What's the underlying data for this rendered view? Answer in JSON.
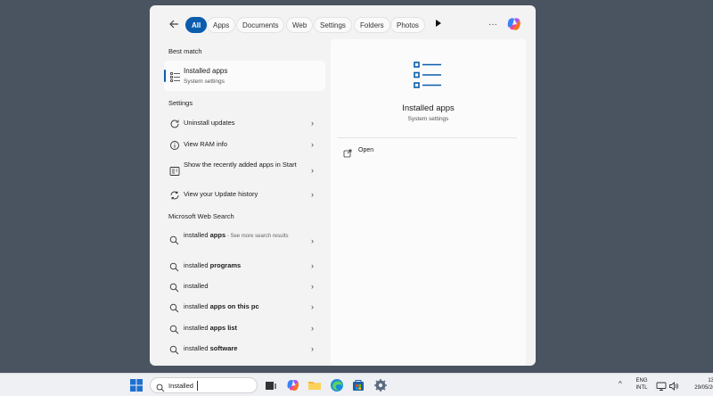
{
  "search_panel": {
    "tabs": [
      {
        "label": "All",
        "active": true
      },
      {
        "label": "Apps"
      },
      {
        "label": "Documents"
      },
      {
        "label": "Web"
      },
      {
        "label": "Settings"
      },
      {
        "label": "Folders"
      },
      {
        "label": "Photos"
      }
    ],
    "more_tabs_icon": "play-arrow-icon",
    "overflow_label": "···",
    "best_match": {
      "heading": "Best match",
      "title": "Installed apps",
      "subtitle": "System settings",
      "icon": "list-icon"
    },
    "settings": {
      "heading": "Settings",
      "items": [
        {
          "label": "Uninstall updates",
          "icon": "refresh-icon"
        },
        {
          "label": "View RAM info",
          "icon": "info-icon"
        },
        {
          "label": "Show the recently added apps in Start",
          "icon": "start-menu-icon"
        },
        {
          "label": "View your Update history",
          "icon": "refresh-icon"
        }
      ]
    },
    "web_search": {
      "heading": "Microsoft Web Search",
      "items": [
        {
          "prefix": "installed ",
          "bold": "apps",
          "hint": " - See more search results"
        },
        {
          "prefix": "installed ",
          "bold": "programs",
          "hint": ""
        },
        {
          "prefix": "installed",
          "bold": "",
          "hint": ""
        },
        {
          "prefix": "installed ",
          "bold": "apps on this pc",
          "hint": ""
        },
        {
          "prefix": "installed ",
          "bold": "apps list",
          "hint": ""
        },
        {
          "prefix": "installed ",
          "bold": "software",
          "hint": ""
        }
      ]
    },
    "preview": {
      "title": "Installed apps",
      "subtitle": "System settings",
      "open_label": "Open"
    }
  },
  "taskbar": {
    "search_value": "Installed",
    "lang_line1": "ENG",
    "lang_line2": "INTL",
    "time": "13:2",
    "date": "29/05/202"
  },
  "colors": {
    "accent": "#0b5cad",
    "desktop": "#4a5460",
    "panel": "#f3f3f3"
  }
}
